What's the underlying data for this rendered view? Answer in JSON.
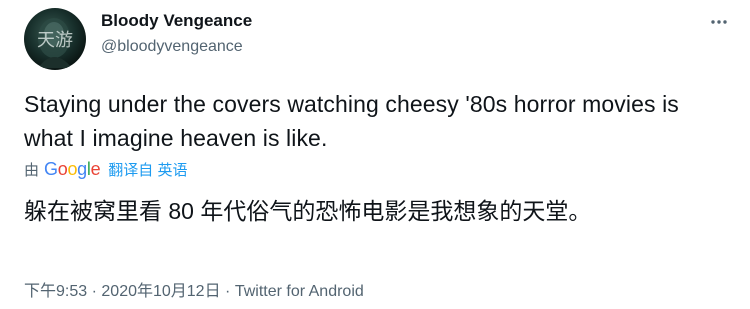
{
  "author": {
    "display_name": "Bloody Vengeance",
    "handle": "@bloodyvengeance",
    "avatar_watermark": "天游"
  },
  "tweet": {
    "text": "Staying under the covers watching cheesy '80s horror movies is what I imagine heaven is like.",
    "translated_text": "躲在被窝里看 80 年代俗气的恐怖电影是我想象的天堂。"
  },
  "translation": {
    "by_label": "由",
    "provider_letters": [
      "G",
      "o",
      "o",
      "g",
      "l",
      "e"
    ],
    "provider_colors": [
      "#4285f4",
      "#ea4335",
      "#fbbc05",
      "#4285f4",
      "#34a853",
      "#ea4335"
    ],
    "target_language": "翻译自 英语"
  },
  "meta": {
    "time": "下午9:53",
    "separator1": "·",
    "date": "2020年10月12日",
    "separator2": "·",
    "source": "Twitter for Android"
  },
  "icons": {
    "more": "more-horizontal-icon"
  },
  "colors": {
    "text_primary": "#0f1419",
    "text_secondary": "#536471",
    "link_blue": "#1d9bf0"
  }
}
